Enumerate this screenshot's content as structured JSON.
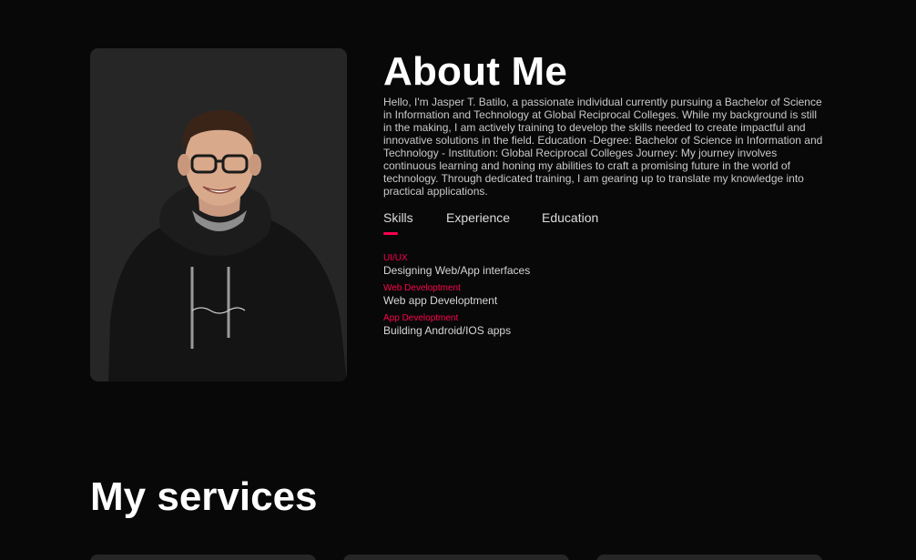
{
  "about": {
    "title": "About Me",
    "paragraph": "Hello, I'm Jasper T. Batilo, a passionate individual currently pursuing a Bachelor of Science in Information and Technology at Global Reciprocal Colleges. While my background is still in the making, I am actively training to develop the skills needed to create impactful and innovative solutions in the field. Education -Degree: Bachelor of Science in Information and Technology - Institution: Global Reciprocal Colleges Journey: My journey involves continuous learning and honing my abilities to craft a promising future in the world of technology. Through dedicated training, I am gearing up to translate my knowledge into practical applications."
  },
  "tabs": [
    {
      "label": "Skills",
      "active": true
    },
    {
      "label": "Experience",
      "active": false
    },
    {
      "label": "Education",
      "active": false
    }
  ],
  "skills": [
    {
      "name": "UI/UX",
      "desc": "Designing Web/App interfaces"
    },
    {
      "name": "Web Developtment",
      "desc": "Web app Developtment"
    },
    {
      "name": "App Developtment",
      "desc": "Building Android/IOS apps"
    }
  ],
  "services": {
    "title": "My services"
  },
  "colors": {
    "background": "#080808",
    "accent": "#ff004f",
    "card": "#262626",
    "text": "#ffffff",
    "muted_text": "#c9c9c9"
  },
  "icons": {
    "profile_photo": "person-portrait"
  }
}
